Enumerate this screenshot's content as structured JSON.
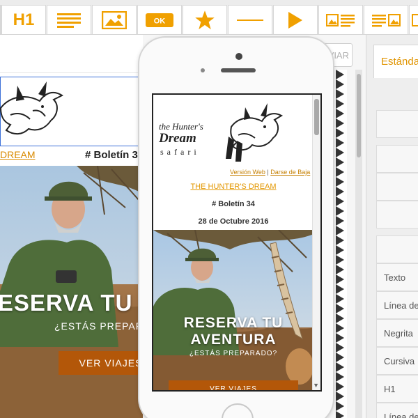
{
  "toolbar": {
    "h1_label": "H1",
    "ok_label": "OK",
    "icons": [
      "text-icon",
      "image-icon",
      "button-icon",
      "star-icon",
      "divider-icon",
      "video-icon",
      "image-text-icon",
      "text-image-icon"
    ]
  },
  "editor": {
    "header_link": "DREAM",
    "bulletin": "# Boletín 34",
    "headline": "RESERVA TU A",
    "subline": "¿ESTÁS PREPARA",
    "button_label": "VER VIAJES"
  },
  "send_button": "ENVIAR",
  "panel": {
    "tab_label": "Estándar",
    "rows": [
      "Texto",
      "Línea de",
      "Negrita",
      "Cursiva",
      "H1",
      "Línea de"
    ]
  },
  "preview": {
    "logo_text_1": "the Hunter's",
    "logo_text_2": "Dream",
    "logo_text_3": "safari",
    "link_web": "Versión Web",
    "link_sep": " | ",
    "link_unsub": "Darse de Baja",
    "title": "THE HUNTER'S DREAM",
    "bulletin": "# Boletín 34",
    "date": "28 de Octubre 2016",
    "headline": "RESERVA TU AVENTURA",
    "subline": "¿ESTÁS PREPARADO?",
    "button_label": "VER VIAJES"
  },
  "colors": {
    "accent": "#f0a000",
    "button_brown": "#b35709"
  }
}
